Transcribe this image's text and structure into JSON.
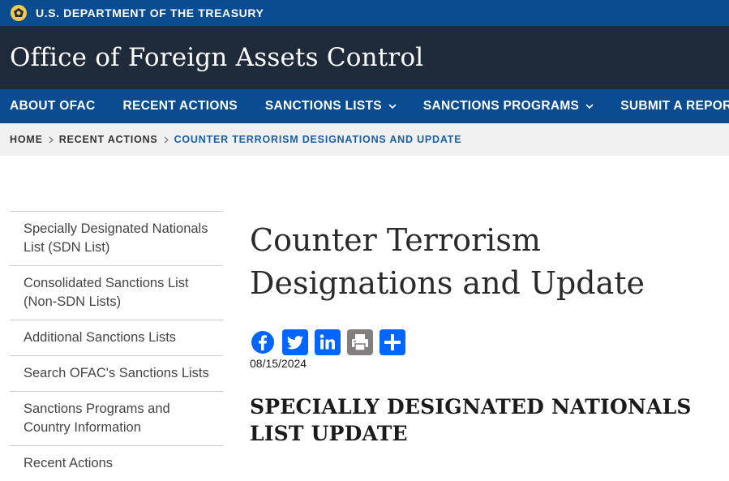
{
  "topbar": {
    "agency": "U.S. DEPARTMENT OF THE TREASURY",
    "seal_icon": "treasury-seal-icon"
  },
  "header": {
    "site_title": "Office of Foreign Assets Control"
  },
  "nav": {
    "items": [
      {
        "label": "ABOUT OFAC",
        "has_dropdown": false
      },
      {
        "label": "RECENT ACTIONS",
        "has_dropdown": false
      },
      {
        "label": "SANCTIONS LISTS",
        "has_dropdown": true
      },
      {
        "label": "SANCTIONS PROGRAMS",
        "has_dropdown": true
      },
      {
        "label": "SUBMIT A REPORT",
        "has_dropdown": false
      }
    ]
  },
  "breadcrumb": {
    "items": [
      "HOME",
      "RECENT ACTIONS",
      "COUNTER TERRORISM DESIGNATIONS AND UPDATE"
    ]
  },
  "sidebar": {
    "items": [
      "Specially Designated Nationals List (SDN List)",
      "Consolidated Sanctions List (Non-SDN Lists)",
      "Additional Sanctions Lists",
      "Search OFAC's Sanctions Lists",
      "Sanctions Programs and Country Information",
      "Recent Actions"
    ]
  },
  "main": {
    "title": "Counter Terrorism Designations and Update",
    "share": [
      "facebook-icon",
      "twitter-icon",
      "linkedin-icon",
      "print-icon",
      "share-icon"
    ],
    "date": "08/15/2024",
    "section_title": "SPECIALLY DESIGNATED NATIONALS LIST UPDATE"
  },
  "colors": {
    "brand_blue": "#0a4c92",
    "header_dark": "#1f2b3b",
    "breadcrumb_bg": "#f0f0f0",
    "breadcrumb_current": "#1a5fa8",
    "share_blue": "#0166ff",
    "print_gray": "#837e7e",
    "seal_gold": "#f2c94c"
  }
}
